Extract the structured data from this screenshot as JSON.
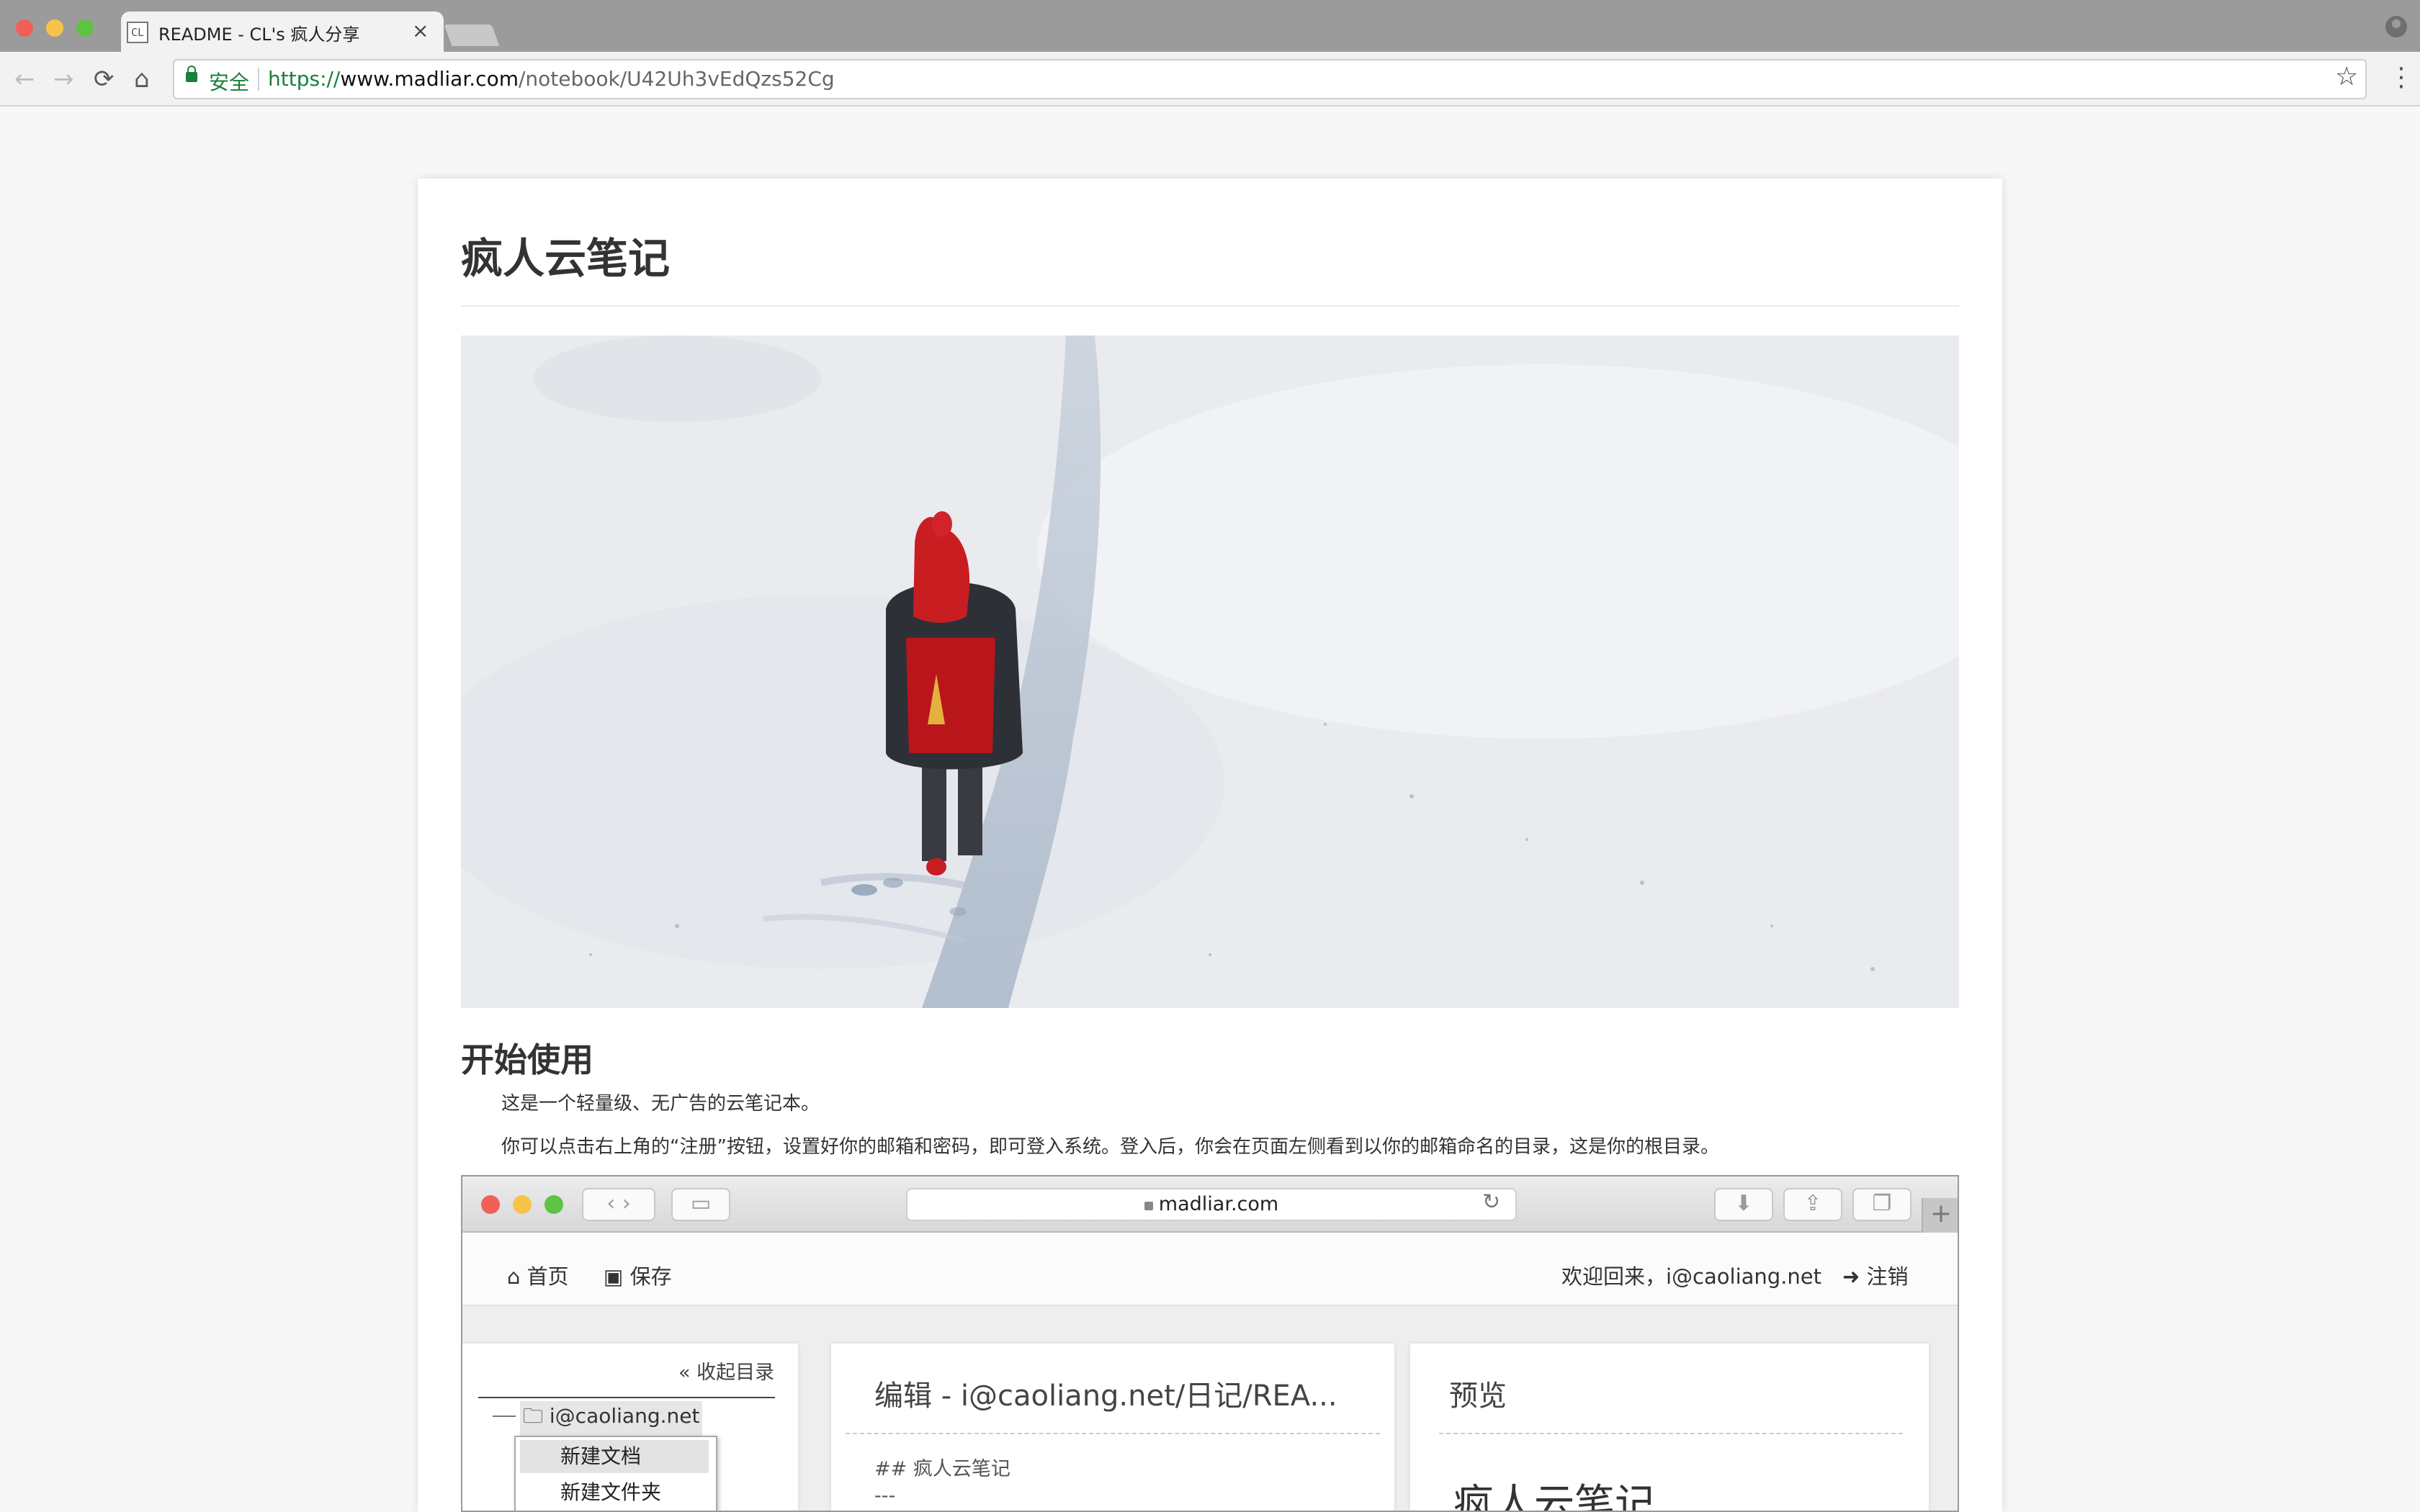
{
  "browser": {
    "tab_title": "README - CL's 疯人分享",
    "tab_favicon_text": "CL",
    "tab_close": "×",
    "back_glyph": "←",
    "forward_glyph": "→",
    "reload_glyph": "⟳",
    "home_glyph": "⌂",
    "secure_label": "安全",
    "url_scheme": "https://",
    "url_host": "www.madliar.com",
    "url_path": "/notebook/U42Uh3vEdQzs52Cg",
    "star_glyph": "☆",
    "menu_glyph": "⋮"
  },
  "page": {
    "title": "疯人云笔记",
    "section_title": "开始使用",
    "paragraphs": [
      "这是一个轻量级、无广告的云笔记本。",
      "你可以点击右上角的“注册”按钮，设置好你的邮箱和密码，即可登入系统。登入后，你会在页面左侧看到以你的邮箱命名的目录，这是你的根目录。"
    ]
  },
  "screenshot": {
    "url": "madliar.com",
    "nav_home": "首页",
    "nav_save": "保存",
    "welcome": "欢迎回来，i@caoliang.net",
    "logout": "注销",
    "collapse": "« 收起目录",
    "root_folder": "i@caoliang.net",
    "context_menu": [
      "新建文档",
      "新建文件夹"
    ],
    "editor_title": "编辑 - i@caoliang.net/日记/REA...",
    "editor_lines": [
      "## 疯人云笔记",
      "---"
    ],
    "preview_title": "预览",
    "preview_heading": "疯人云笔记"
  },
  "colors": {
    "secure_green": "#188038",
    "traffic_red": "#f25f58",
    "traffic_yellow": "#f6c34a",
    "traffic_green": "#5dc343",
    "hood_red": "#c81e22"
  }
}
